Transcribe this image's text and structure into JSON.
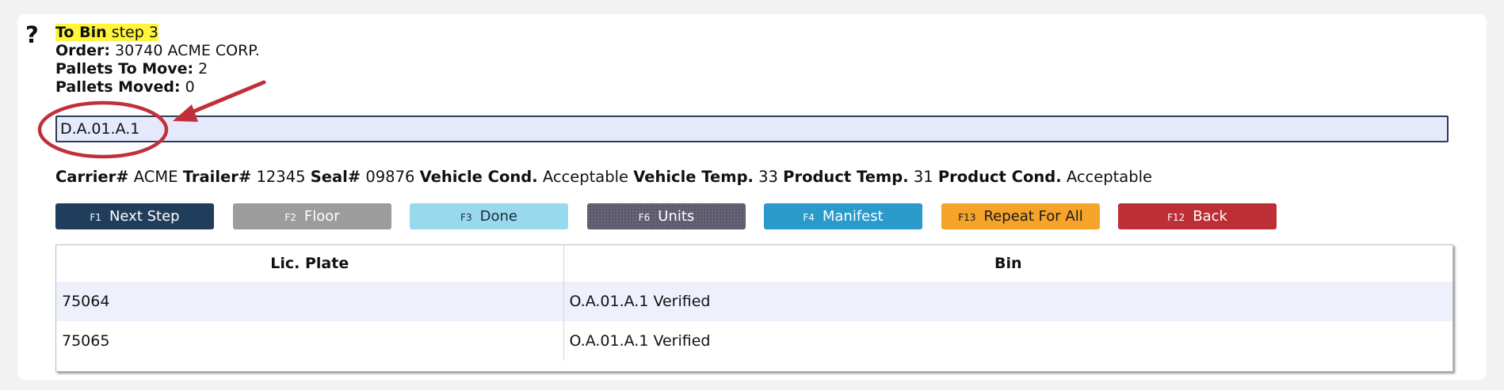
{
  "header": {
    "help_icon": "?",
    "screen_title": "To Bin",
    "screen_step": "step 3",
    "order_label": "Order:",
    "order_value": "30740 ACME CORP.",
    "pallets_to_move_label": "Pallets To Move:",
    "pallets_to_move_value": "2",
    "pallets_moved_label": "Pallets Moved:",
    "pallets_moved_value": "0"
  },
  "scan": {
    "value": "D.A.01.A.1"
  },
  "details": {
    "carrier_label": "Carrier#",
    "carrier_value": "ACME",
    "trailer_label": "Trailer#",
    "trailer_value": "12345",
    "seal_label": "Seal#",
    "seal_value": "09876",
    "vehicle_cond_label": "Vehicle Cond.",
    "vehicle_cond_value": "Acceptable",
    "vehicle_temp_label": "Vehicle Temp.",
    "vehicle_temp_value": "33",
    "product_temp_label": "Product Temp.",
    "product_temp_value": "31",
    "product_cond_label": "Product Cond.",
    "product_cond_value": "Acceptable"
  },
  "buttons": {
    "next_step": {
      "key": "F1",
      "label": "Next Step"
    },
    "floor": {
      "key": "F2",
      "label": "Floor"
    },
    "done": {
      "key": "F3",
      "label": "Done"
    },
    "units": {
      "key": "F6",
      "label": "Units"
    },
    "manifest": {
      "key": "F4",
      "label": "Manifest"
    },
    "repeat_for_all": {
      "key": "F13",
      "label": "Repeat For All"
    },
    "back": {
      "key": "F12",
      "label": "Back"
    }
  },
  "table": {
    "columns": [
      "Lic. Plate",
      "Bin"
    ],
    "rows": [
      {
        "plate": "75064",
        "bin": "O.A.01.A.1 Verified"
      },
      {
        "plate": "75065",
        "bin": "O.A.01.A.1 Verified"
      }
    ]
  },
  "colors": {
    "highlight": "#fff53c",
    "annotation": "#c0303a",
    "next_step": "#213d5c",
    "floor": "#9c9c9c",
    "done": "#98d9ee",
    "units": "#5d5a6d",
    "manifest": "#2a9acb",
    "repeat_for_all": "#f6a32a",
    "back": "#bd2e35"
  }
}
